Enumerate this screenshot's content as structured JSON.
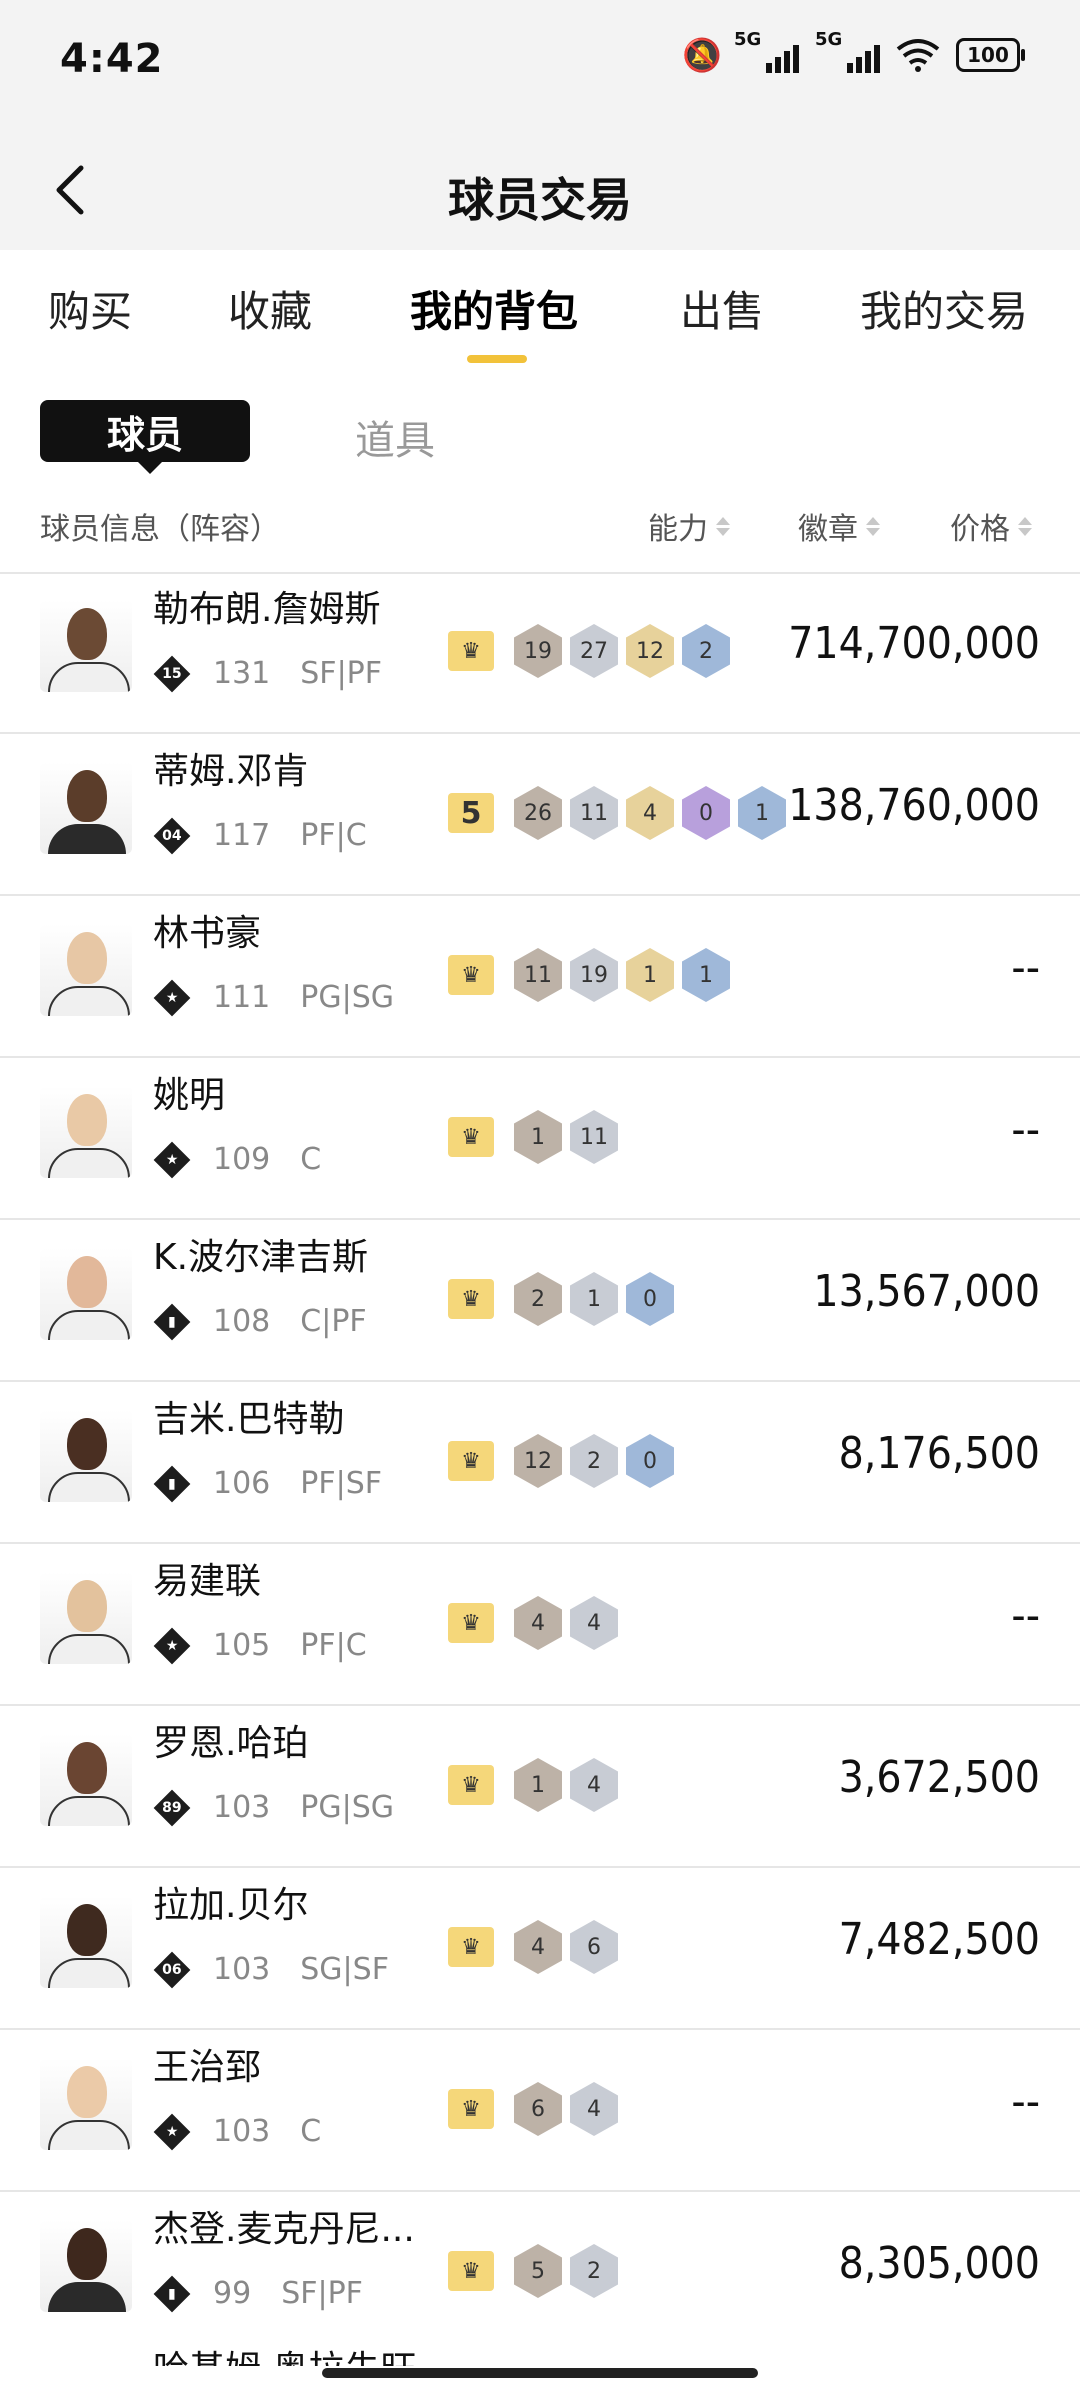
{
  "status_bar": {
    "time": "4:42",
    "signal1": "5G",
    "signal2": "5G",
    "wifi_badge": "6",
    "battery": "100"
  },
  "header": {
    "title": "球员交易"
  },
  "tabs": [
    {
      "label": "购买"
    },
    {
      "label": "收藏"
    },
    {
      "label": "我的背包"
    },
    {
      "label": "出售"
    },
    {
      "label": "我的交易"
    }
  ],
  "active_tab": "我的背包",
  "subtabs": {
    "active": "球员",
    "inactive": "道具"
  },
  "columns": {
    "info": "球员信息（阵容）",
    "ability": "能力",
    "badge": "徽章",
    "price": "价格"
  },
  "players": [
    {
      "name": "勒布朗.詹姆斯",
      "rank_badge": "15",
      "rating": "131",
      "position": "SF|PF",
      "level": "",
      "badges": [
        [
          "19",
          "bronze"
        ],
        [
          "27",
          "silver"
        ],
        [
          "12",
          "gold"
        ],
        [
          "2",
          "blue"
        ]
      ],
      "price": "714,700,000",
      "skin": "#6b4a34",
      "jersey": "light"
    },
    {
      "name": "蒂姆.邓肯",
      "rank_badge": "04",
      "rating": "117",
      "position": "PF|C",
      "level": "5",
      "badges": [
        [
          "26",
          "bronze"
        ],
        [
          "11",
          "silver"
        ],
        [
          "4",
          "gold"
        ],
        [
          "0",
          "purple"
        ],
        [
          "1",
          "blue"
        ]
      ],
      "price": "138,760,000",
      "skin": "#5b3d2a",
      "jersey": "dark"
    },
    {
      "name": "林书豪",
      "rank_badge": "★",
      "rating": "111",
      "position": "PG|SG",
      "level": "",
      "badges": [
        [
          "11",
          "bronze"
        ],
        [
          "19",
          "silver"
        ],
        [
          "1",
          "gold"
        ],
        [
          "1",
          "blue"
        ]
      ],
      "price": "--",
      "skin": "#e7c7a5",
      "jersey": "light"
    },
    {
      "name": "姚明",
      "rank_badge": "★",
      "rating": "109",
      "position": "C",
      "level": "",
      "badges": [
        [
          "1",
          "bronze"
        ],
        [
          "11",
          "silver"
        ]
      ],
      "price": "--",
      "skin": "#e9c9a6",
      "jersey": "light"
    },
    {
      "name": "K.波尔津吉斯",
      "rank_badge": "▮",
      "rating": "108",
      "position": "C|PF",
      "level": "",
      "badges": [
        [
          "2",
          "bronze"
        ],
        [
          "1",
          "silver"
        ],
        [
          "0",
          "blue"
        ]
      ],
      "price": "13,567,000",
      "skin": "#e2b89a",
      "jersey": "light"
    },
    {
      "name": "吉米.巴特勒",
      "rank_badge": "▮",
      "rating": "106",
      "position": "PF|SF",
      "level": "",
      "badges": [
        [
          "12",
          "bronze"
        ],
        [
          "2",
          "silver"
        ],
        [
          "0",
          "blue"
        ]
      ],
      "price": "8,176,500",
      "skin": "#4a2f22",
      "jersey": "light"
    },
    {
      "name": "易建联",
      "rank_badge": "★",
      "rating": "105",
      "position": "PF|C",
      "level": "",
      "badges": [
        [
          "4",
          "bronze"
        ],
        [
          "4",
          "silver"
        ]
      ],
      "price": "--",
      "skin": "#e3c29d",
      "jersey": "light"
    },
    {
      "name": "罗恩.哈珀",
      "rank_badge": "89",
      "rating": "103",
      "position": "PG|SG",
      "level": "",
      "badges": [
        [
          "1",
          "bronze"
        ],
        [
          "4",
          "silver"
        ]
      ],
      "price": "3,672,500",
      "skin": "#6a4532",
      "jersey": "light"
    },
    {
      "name": "拉加.贝尔",
      "rank_badge": "06",
      "rating": "103",
      "position": "SG|SF",
      "level": "",
      "badges": [
        [
          "4",
          "bronze"
        ],
        [
          "6",
          "silver"
        ]
      ],
      "price": "7,482,500",
      "skin": "#3f2a1f",
      "jersey": "light"
    },
    {
      "name": "王治郅",
      "rank_badge": "★",
      "rating": "103",
      "position": "C",
      "level": "",
      "badges": [
        [
          "6",
          "bronze"
        ],
        [
          "4",
          "silver"
        ]
      ],
      "price": "--",
      "skin": "#ebcaa8",
      "jersey": "light"
    },
    {
      "name": "杰登.麦克丹尼...",
      "rank_badge": "▮",
      "rating": "99",
      "position": "SF|PF",
      "level": "",
      "badges": [
        [
          "5",
          "bronze"
        ],
        [
          "2",
          "silver"
        ]
      ],
      "price": "8,305,000",
      "skin": "#3e281d",
      "jersey": "dark"
    }
  ],
  "partial_row_name": "哈基姆.奥拉朱旺"
}
